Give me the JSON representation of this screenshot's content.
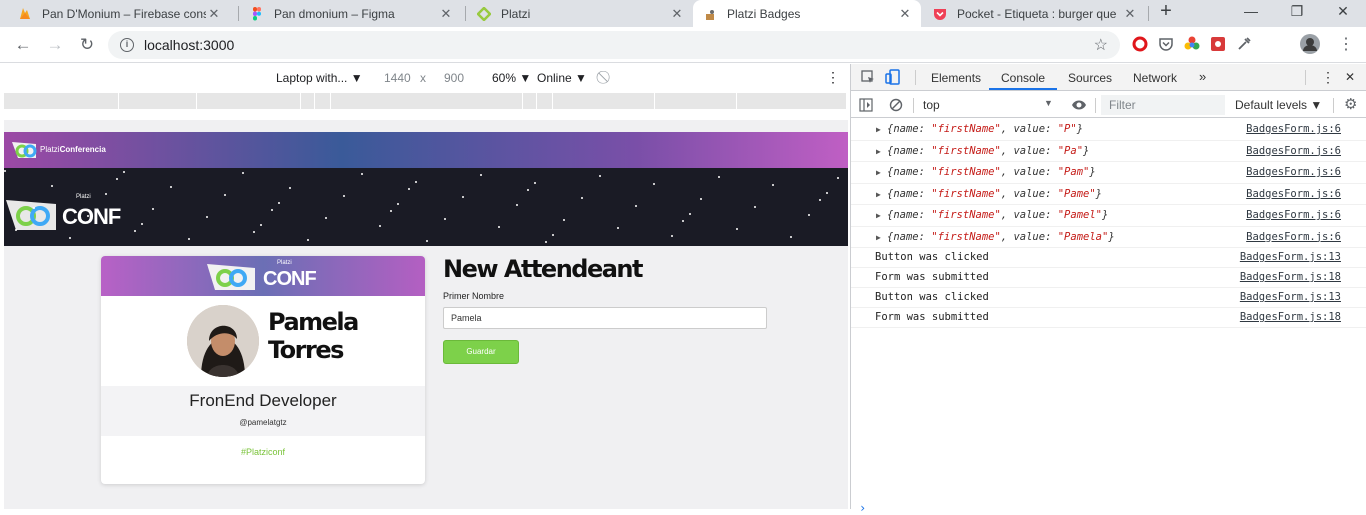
{
  "tabs": [
    {
      "title": "Pan D'Monium – Firebase cons",
      "favicon": "firebase-icon"
    },
    {
      "title": "Pan dmonium – Figma",
      "favicon": "figma-icon"
    },
    {
      "title": "Platzi",
      "favicon": "platzi-icon"
    },
    {
      "title": "Platzi Badges",
      "favicon": "react-icon",
      "active": true
    },
    {
      "title": "Pocket - Etiqueta : burger que",
      "favicon": "pocket-icon"
    }
  ],
  "address": {
    "url": "localhost:3000"
  },
  "device_toolbar": {
    "device": "Laptop with...",
    "width": "1440",
    "times": "x",
    "height": "900",
    "zoom": "60%",
    "throttle": "Online"
  },
  "page": {
    "nav_brand_light": "Platzi",
    "nav_brand_bold": "Conferencia",
    "hero_platzi": "Platzi",
    "hero_conf": "CONF",
    "badge": {
      "header_platzi": "Platzi",
      "header_conf": "CONF",
      "first_name": "Pamela",
      "last_name": "Torres",
      "job_title": "FronEnd Developer",
      "handle": "@pamelatgtz",
      "hashtag": "#Platziconf"
    },
    "form": {
      "title": "New Attendeant",
      "label": "Primer Nombre",
      "value": "Pamela",
      "button": "Guardar"
    }
  },
  "devtools": {
    "tabs": [
      "Elements",
      "Console",
      "Sources",
      "Network"
    ],
    "active_tab": "Console",
    "context": "top",
    "filter_placeholder": "Filter",
    "levels": "Default levels",
    "logs": [
      {
        "kind": "object",
        "key": "firstName",
        "value": "P",
        "source": "BadgesForm.js:6"
      },
      {
        "kind": "object",
        "key": "firstName",
        "value": "Pa",
        "source": "BadgesForm.js:6"
      },
      {
        "kind": "object",
        "key": "firstName",
        "value": "Pam",
        "source": "BadgesForm.js:6"
      },
      {
        "kind": "object",
        "key": "firstName",
        "value": "Pame",
        "source": "BadgesForm.js:6"
      },
      {
        "kind": "object",
        "key": "firstName",
        "value": "Pamel",
        "source": "BadgesForm.js:6"
      },
      {
        "kind": "object",
        "key": "firstName",
        "value": "Pamela",
        "source": "BadgesForm.js:6"
      },
      {
        "kind": "text",
        "text": "Button was clicked",
        "source": "BadgesForm.js:13"
      },
      {
        "kind": "text",
        "text": "Form was submitted",
        "source": "BadgesForm.js:18"
      },
      {
        "kind": "text",
        "text": "Button was clicked",
        "source": "BadgesForm.js:13"
      },
      {
        "kind": "text",
        "text": "Form was submitted",
        "source": "BadgesForm.js:18"
      }
    ]
  },
  "colors": {
    "accent_green": "#7dd14a",
    "devtools_blue": "#1a73e8",
    "string_red": "#c41a16"
  }
}
